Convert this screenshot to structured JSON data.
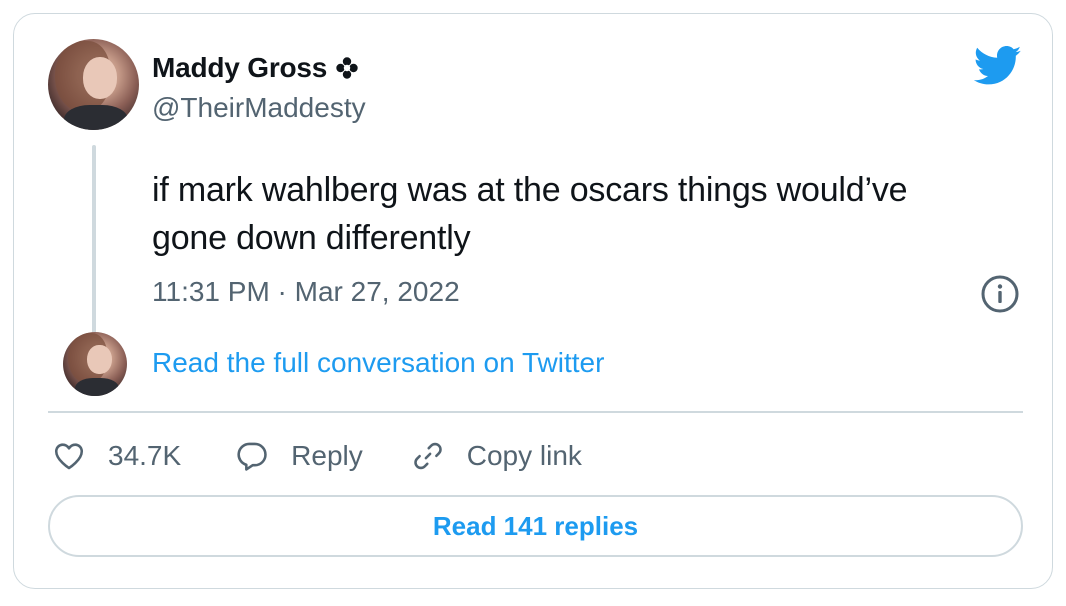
{
  "author": {
    "name": "Maddy Gross",
    "handle": "@TheirMaddesty",
    "badge_icon": "flower-icon"
  },
  "tweet": {
    "text": "if mark wahlberg was at the oscars things would’ve gone down differently",
    "timestamp": "11:31 PM · Mar 27, 2022"
  },
  "conversation_link": "Read the full conversation on Twitter",
  "actions": {
    "like_count": "34.7K",
    "reply_label": "Reply",
    "copy_link_label": "Copy link"
  },
  "read_replies_label": "Read 141 replies",
  "icons": {
    "logo": "twitter-bird-icon",
    "info": "info-icon",
    "like": "heart-icon",
    "reply": "speech-bubble-icon",
    "copy_link": "link-icon"
  },
  "colors": {
    "accent": "#1d9bf0",
    "secondary_text": "#536471",
    "border": "#cfd9de",
    "text": "#0f1419"
  }
}
